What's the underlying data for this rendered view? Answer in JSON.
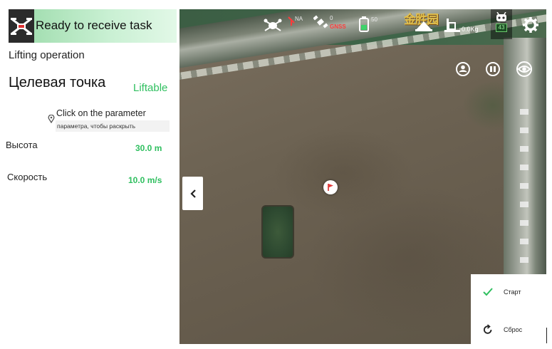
{
  "status": {
    "text": "Ready to receive task"
  },
  "panel": {
    "section_title": "Lifting operation",
    "target_title": "Целевая точка",
    "liftable_label": "Liftable",
    "hint_text": "Click on the parameter",
    "hint_sub": "параметра, чтобы раскрыть",
    "params": [
      {
        "label": "Высота",
        "value": "30.0 m"
      },
      {
        "label": "Скорость",
        "value": "10.0 m/s"
      }
    ]
  },
  "topbar": {
    "rtk_label": "NA",
    "satellite_count": "0",
    "gnss_label": "GNSS",
    "battery_value": "50",
    "weight_value": "0.0Kg",
    "drone_badge": "43",
    "sign_text": "金胜园"
  },
  "actions": {
    "start_label": "Старт",
    "reset_label": "Сброс"
  },
  "colors": {
    "accent_green": "#2fbf5f",
    "status_header": "#98d9a7",
    "warning_red": "#ff3b3b"
  }
}
